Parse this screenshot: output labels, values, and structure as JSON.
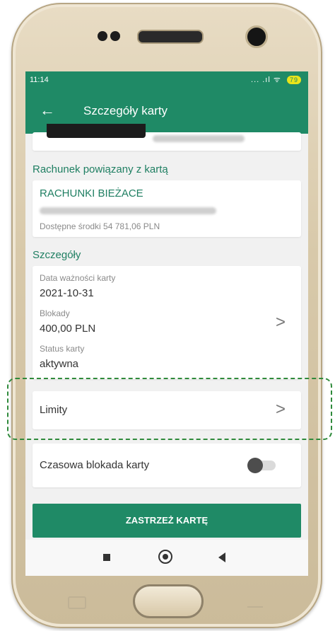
{
  "status_bar": {
    "time": "11:14",
    "signal_text": "... .ıl ᯤ",
    "battery": "79"
  },
  "app_bar": {
    "back_symbol": "←",
    "title": "Szczegóły karty"
  },
  "card_section": {
    "holder_name_blurred": "DAMIAN PINOWAR"
  },
  "account_section": {
    "header": "Rachunek powiązany z kartą",
    "account_name": "RACHUNKI BIEŻACE",
    "available_funds": "Dostępne środki 54 781,06 PLN"
  },
  "details_section": {
    "header": "Szczegóły",
    "expiry_label": "Data ważności karty",
    "expiry_value": "2021-10-31",
    "blocks_label": "Blokady",
    "blocks_value": "400,00 PLN",
    "status_label": "Status karty",
    "status_value": "aktywna",
    "chevron": ">"
  },
  "limits_row": {
    "label": "Limity",
    "chevron": ">"
  },
  "temp_block": {
    "label": "Czasowa blokada karty",
    "enabled": false
  },
  "reserve_button": {
    "label": "ZASTRZEŻ KARTĘ"
  },
  "colors": {
    "primary": "#1f8a66",
    "accent_text": "#1f7f62",
    "highlight_dash": "#2f8a3b"
  },
  "icons": [
    "back-arrow-icon",
    "chevron-right-icon",
    "nav-recents-icon",
    "nav-home-icon",
    "nav-back-icon"
  ]
}
